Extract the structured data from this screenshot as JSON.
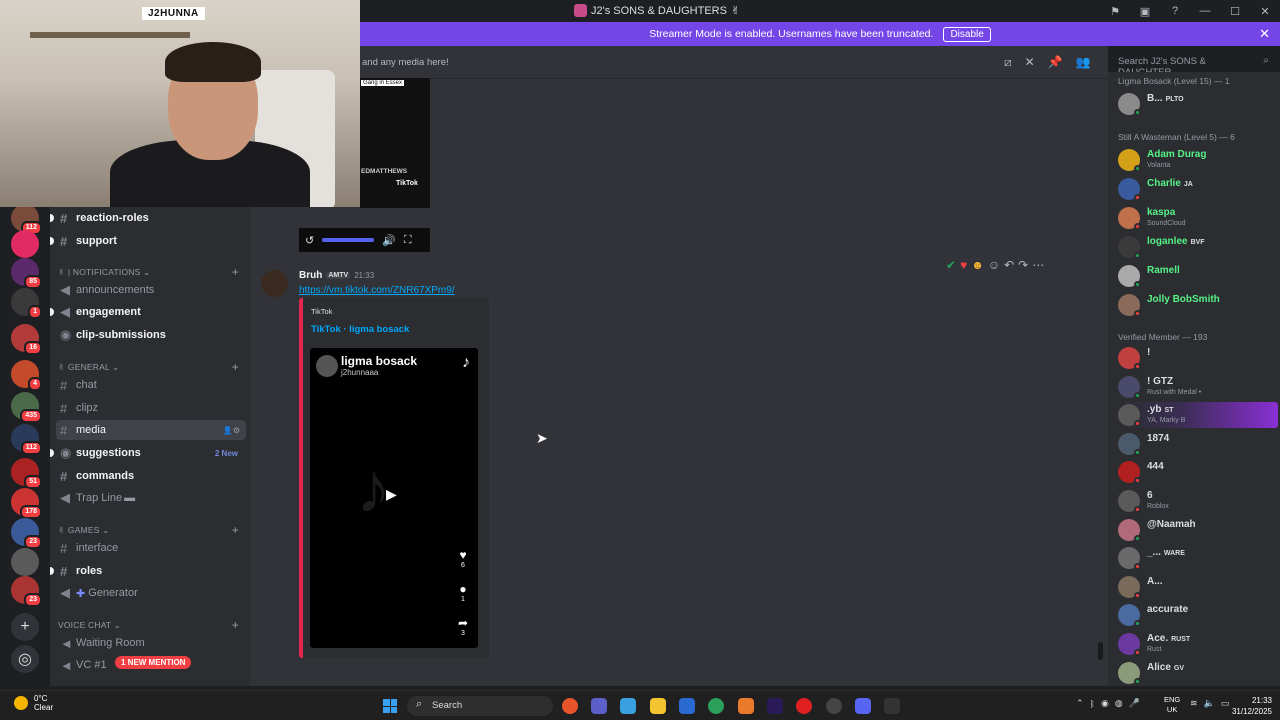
{
  "window": {
    "title": "J2's SONS & DAUGHTERS"
  },
  "banner": {
    "text": "Streamer Mode is enabled. Usernames have been truncated.",
    "button": "Disable"
  },
  "webcam": {
    "nametag": "J2HUNNA"
  },
  "header": {
    "topic": "and any media here!",
    "search_placeholder": "Search J2's SONS & DAUGHTER..."
  },
  "servers": [
    {
      "badge": "112",
      "color": "#7a4a3a"
    },
    {
      "badge": "",
      "color": "#e22a64"
    },
    {
      "badge": "85",
      "color": "#5a2a6a"
    },
    {
      "badge": "1",
      "color": "#3a3a3a"
    },
    {
      "badge": "16",
      "color": "#b33a3a"
    },
    {
      "badge": "4",
      "color": "#c34a2a"
    },
    {
      "badge": "435",
      "color": "#4a6a4a"
    },
    {
      "badge": "112",
      "color": "#2a3a5a"
    },
    {
      "badge": "51",
      "color": "#aa2222"
    },
    {
      "badge": "178",
      "color": "#cc3333"
    },
    {
      "badge": "23",
      "color": "#3a5a9a"
    },
    {
      "badge": "",
      "color": "#5a5a5a"
    },
    {
      "badge": "23",
      "color": "#aa3333"
    }
  ],
  "channels": {
    "reaction_roles": "reaction-roles",
    "support": "support",
    "cat_notifications": "| NOTIFICATIONS",
    "announcements": "announcements",
    "engagement": "engagement",
    "clip_submissions": "clip-submissions",
    "cat_general": "GENERAL",
    "chat": "chat",
    "clipz": "clipz",
    "media": "media",
    "suggestions": "suggestions",
    "suggestions_new": "2 New",
    "commands": "commands",
    "trap_line": "Trap Line",
    "cat_games": "GAMES",
    "interface": "interface",
    "roles": "roles",
    "generator": "Generator",
    "cat_voice": "VOICE CHAT",
    "waiting_room": "Waiting Room",
    "vc1": "VC #1",
    "new_mention": "1 NEW MENTION"
  },
  "prev_video": {
    "caption": "Gang in Essex",
    "name": "EDMATTHEWS",
    "tiktok": "TikTok"
  },
  "message": {
    "author": "Bruh",
    "tag": "AMTV",
    "time": "21:33",
    "link": "https://vm.tiktok.com/ZNR67XPm9/",
    "embed_provider": "TikTok",
    "embed_title": "TikTok · ligma bosack",
    "tiktok_name": "ligma bosack",
    "tiktok_handle": "j2hunnaaa",
    "likes": "6",
    "comments": "1",
    "shares": "3"
  },
  "members": {
    "group1": "Ligma Bosack (Level 15) — 1",
    "group2": "Still A Wasteman (Level 5) — 6",
    "group3": "Verified Member — 193",
    "list1": [
      {
        "name": "B...",
        "badge": "PLTO",
        "sub": "",
        "color": "#dbdee1",
        "av": "#8a8a8a",
        "st": "#23a55a"
      }
    ],
    "list2": [
      {
        "name": "Adam Durag",
        "badge": "",
        "sub": "Volanta",
        "color": "#57f287",
        "av": "#d4a017",
        "st": "#23a55a"
      },
      {
        "name": "Charlie",
        "badge": "JA",
        "sub": "",
        "color": "#57f287",
        "av": "#3a5aa0",
        "st": "#f23f43"
      },
      {
        "name": "kaspa",
        "badge": "",
        "sub": "SoundCloud",
        "color": "#57f287",
        "av": "#c0704a",
        "st": "#f23f43"
      },
      {
        "name": "loganlee",
        "badge": "BVF",
        "sub": "",
        "color": "#57f287",
        "av": "#3a3a3a",
        "st": "#23a55a"
      },
      {
        "name": "Ramell",
        "badge": "",
        "sub": "",
        "color": "#57f287",
        "av": "#aaaaaa",
        "st": "#23a55a"
      },
      {
        "name": "Jolly BobSmith",
        "badge": "",
        "sub": "",
        "color": "#57f287",
        "av": "#8a6a5a",
        "st": "#f23f43"
      }
    ],
    "list3": [
      {
        "name": "!",
        "badge": "",
        "sub": "",
        "color": "#dbdee1",
        "av": "#c04040",
        "st": "#f23f43"
      },
      {
        "name": "! GTZ",
        "badge": "",
        "sub": "Rust with Medal •",
        "color": "#dbdee1",
        "av": "#4a4a6a",
        "st": "#23a55a"
      },
      {
        "name": ".yb",
        "badge": "ST",
        "sub": "YA, Marky B",
        "color": "#dbdee1",
        "av": "#5a5a5a",
        "st": "#f23f43"
      },
      {
        "name": "1874",
        "badge": "",
        "sub": "",
        "color": "#dbdee1",
        "av": "#4a5a6a",
        "st": "#23a55a"
      },
      {
        "name": "444",
        "badge": "",
        "sub": "",
        "color": "#dbdee1",
        "av": "#b02020",
        "st": "#f23f43"
      },
      {
        "name": "6",
        "badge": "",
        "sub": "Roblox",
        "color": "#dbdee1",
        "av": "#5a5a5a",
        "st": "#f23f43"
      },
      {
        "name": "@Naamah",
        "badge": "",
        "sub": "",
        "color": "#dbdee1",
        "av": "#b06a7a",
        "st": "#23a55a"
      },
      {
        "name": "_...",
        "badge": "WARE",
        "sub": "",
        "color": "#dbdee1",
        "av": "#6a6a6a",
        "st": "#f23f43"
      },
      {
        "name": "A...",
        "badge": "",
        "sub": "",
        "color": "#dbdee1",
        "av": "#7a6a5a",
        "st": "#f23f43"
      },
      {
        "name": "accurate",
        "badge": "",
        "sub": "",
        "color": "#dbdee1",
        "av": "#4a6aa0",
        "st": "#23a55a"
      },
      {
        "name": "Ace.",
        "badge": "RUST",
        "sub": "Rust",
        "color": "#dbdee1",
        "av": "#6a3aa0",
        "st": "#f23f43"
      },
      {
        "name": "Alice",
        "badge": "GV",
        "sub": "",
        "color": "#dbdee1",
        "av": "#8a9a7a",
        "st": "#23a55a"
      }
    ]
  },
  "taskbar": {
    "temp": "0°C",
    "weather": "Clear",
    "search": "Search",
    "lang1": "ENG",
    "lang2": "UK",
    "time": "21:33",
    "date": "31/12/2025"
  }
}
